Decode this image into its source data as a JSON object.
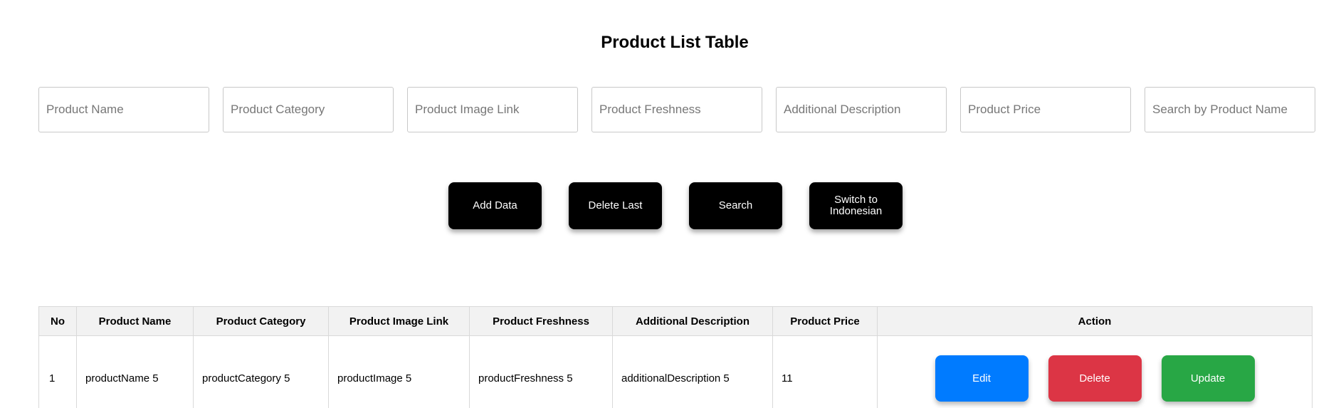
{
  "title": "Product List Table",
  "inputs": {
    "product_name": "Product Name",
    "product_category": "Product Category",
    "product_image_link": "Product Image Link",
    "product_freshness": "Product Freshness",
    "additional_description": "Additional Description",
    "product_price": "Product Price",
    "search": "Search by Product Name"
  },
  "buttons": {
    "add_data": "Add Data",
    "delete_last": "Delete Last",
    "search": "Search",
    "switch_language": "Switch to Indonesian"
  },
  "table": {
    "headers": [
      "No",
      "Product Name",
      "Product Category",
      "Product Image Link",
      "Product Freshness",
      "Additional Description",
      "Product Price",
      "Action"
    ],
    "rows": [
      {
        "no": "1",
        "product_name": "productName 5",
        "product_category": "productCategory 5",
        "product_image_link": "productImage 5",
        "product_freshness": "productFreshness 5",
        "additional_description": "additionalDescription 5",
        "product_price": "11"
      }
    ],
    "actions": {
      "edit": "Edit",
      "delete": "Delete",
      "update": "Update"
    }
  },
  "colors": {
    "edit": "#007bff",
    "delete": "#dc3545",
    "update": "#28a745",
    "primary_button": "#000000",
    "header_bg": "#f2f2f2"
  }
}
